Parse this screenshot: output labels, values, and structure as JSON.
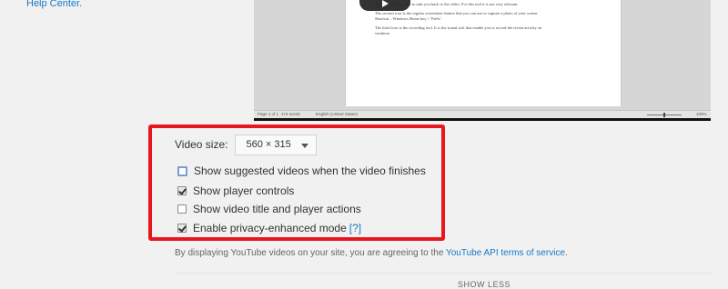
{
  "help_center": "Help Center.",
  "preview": {
    "doc_lines": [
      "The first icon is a link to take you back to the video. For this tool it is not very relevant.",
      "The second icon is the regular screenshot feature that you can use to capture a photo of your screen.",
      "Shortcut – Windows Home key + 'PrtSc'",
      "The third icon is the recording tool. It is the actual tool that enable you to record the recent activity on",
      "windows"
    ],
    "status_left": "Page 1 of 1",
    "status_words": "474 words",
    "status_lang": "English (United States)",
    "zoom": "100%"
  },
  "options": {
    "video_size_label": "Video size:",
    "video_size_value": "560 × 315",
    "checkboxes": [
      {
        "label": "Show suggested videos when the video finishes",
        "checked": false
      },
      {
        "label": "Show player controls",
        "checked": true
      },
      {
        "label": "Show video title and player actions",
        "checked": false
      },
      {
        "label": "Enable privacy-enhanced mode",
        "checked": true
      }
    ],
    "help_marker": "[?]"
  },
  "terms": {
    "text": "By displaying YouTube videos on your site, you are agreeing to the ",
    "link": "YouTube API terms of service",
    "end": "."
  },
  "show_less": "SHOW LESS",
  "colors": {
    "highlight": "#e8161f",
    "link": "#167ac6",
    "background": "#f1f1f1"
  }
}
